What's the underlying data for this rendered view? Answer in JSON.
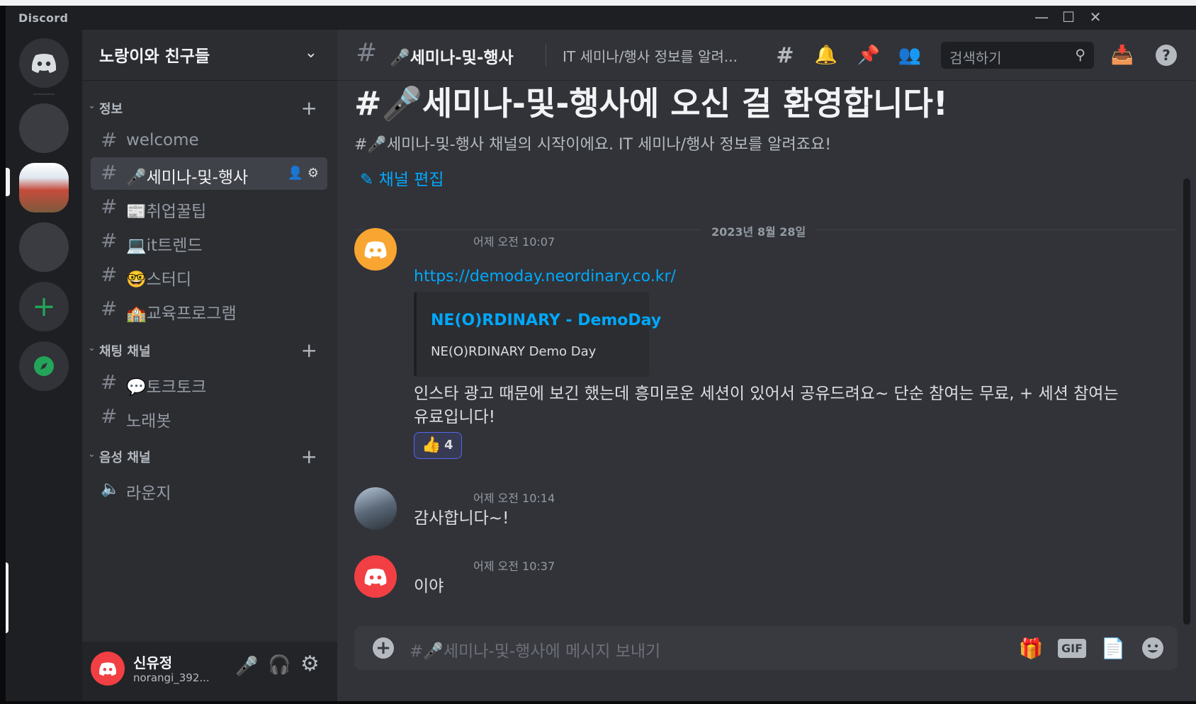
{
  "app": {
    "title": "Discord"
  },
  "server": {
    "name": "노랑이와 친구들"
  },
  "categories": {
    "info": {
      "label": "정보"
    },
    "chat": {
      "label": "채팅 채널"
    },
    "voice": {
      "label": "음성 채널"
    }
  },
  "channels": {
    "welcome": "welcome",
    "seminar": "🎤세미나-및-행사",
    "jobtips": "📰취업꿀팁",
    "ittrend": "💻it트렌드",
    "study": "🤓스터디",
    "edu": "🏫교육프로그램",
    "talk": "💬토크토크",
    "karaoke": "노래봇",
    "lounge": "라운지"
  },
  "user": {
    "display_name": "신유정",
    "username": "norangi_392..."
  },
  "header": {
    "channel_title": "🎤세미나-및-행사",
    "topic": "IT 세미나/행사 정보를 알려...",
    "search_placeholder": "검색하기"
  },
  "welcome": {
    "title": "#🎤세미나-및-행사에 오신 걸 환영합니다!",
    "subtitle": "#🎤세미나-및-행사 채널의 시작이에요. IT 세미나/행사 정보를 알려죠요!",
    "edit_label": "채널 편집"
  },
  "date_divider": "2023년 8월 28일",
  "messages": [
    {
      "time": "어제 오전 10:07",
      "link": "https://demoday.neordinary.co.kr/",
      "embed": {
        "title": "NE(O)RDINARY - DemoDay",
        "description": "NE(O)RDINARY Demo Day"
      },
      "text": "인스타 광고 때문에 보긴 했는데 흥미로운 세션이 있어서 공유드려요~ 단순 참여는 무료, + 세션 참여는 유료입니다!",
      "reaction": {
        "emoji": "👍",
        "count": "4"
      }
    },
    {
      "time": "어제 오전 10:14",
      "text": "감사합니다~!"
    },
    {
      "time": "어제 오전 10:37",
      "text": "이야"
    }
  ],
  "composer": {
    "placeholder": "#🎤세미나-및-행사에 메시지 보내기",
    "gif_label": "GIF"
  },
  "colors": {
    "blurple": "#5865f2",
    "link": "#00a8fc",
    "green": "#23a559",
    "orange": "#f8a532",
    "red": "#f23f43"
  }
}
